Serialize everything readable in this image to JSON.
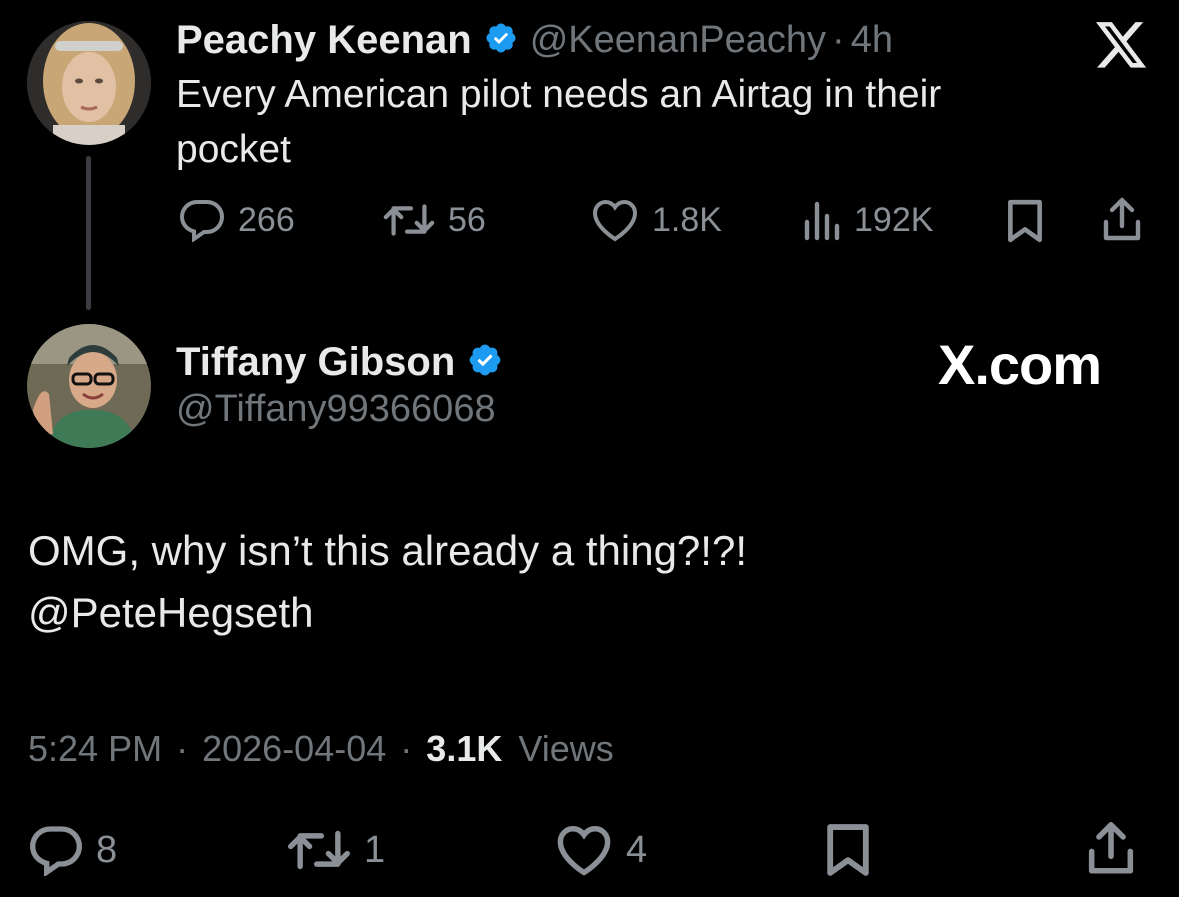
{
  "original_tweet": {
    "author_name": "Peachy Keenan",
    "author_handle": "@KeenanPeachy",
    "separator": "·",
    "time_ago": "4h",
    "text_line1": "Every American pilot needs an Airtag in their",
    "text_line2": "pocket",
    "replies": "266",
    "reposts": "56",
    "likes": "1.8K",
    "views": "192K"
  },
  "reply_tweet": {
    "author_name": "Tiffany Gibson",
    "author_handle": "@Tiffany99366068",
    "brand": "X.com",
    "text_line1": "OMG, why isn’t this already a thing?!?!",
    "text_line2": "@PeteHegseth",
    "time": "5:24 PM",
    "sep1": "·",
    "date": "2026-04-04",
    "sep2": "·",
    "views_count": "3.1K",
    "views_label": "Views",
    "replies": "8",
    "reposts": "1",
    "likes": "4"
  },
  "colors": {
    "background": "#000000",
    "text": "#e7e9ea",
    "secondary": "#71767b",
    "verified": "#1d9bf0",
    "thread_line": "#3a3d41"
  },
  "icons": [
    "verified-badge-icon",
    "x-logo-icon",
    "reply-icon",
    "repost-icon",
    "like-icon",
    "views-icon",
    "bookmark-icon",
    "share-icon"
  ]
}
